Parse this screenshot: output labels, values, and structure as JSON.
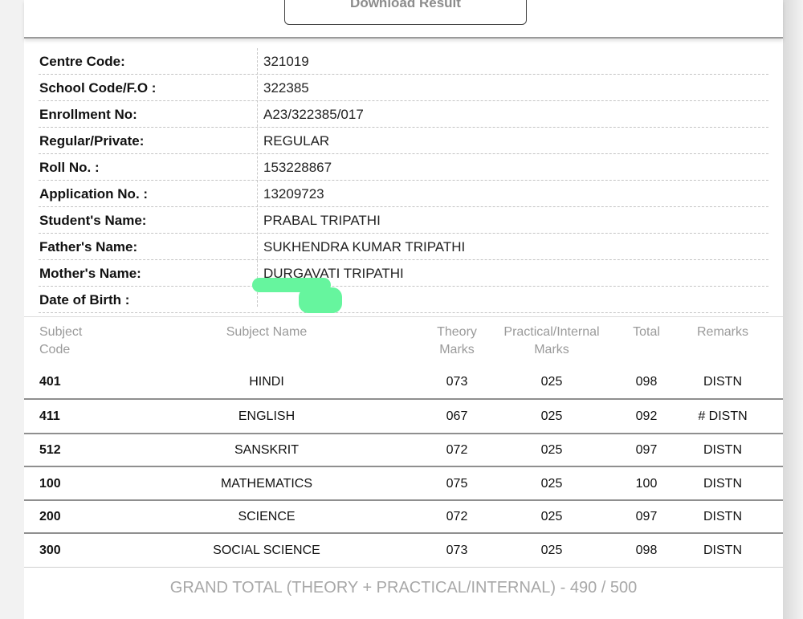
{
  "button": {
    "download_label": "Download Result"
  },
  "info": [
    {
      "label": "Centre Code:",
      "value": "321019"
    },
    {
      "label": "School Code/F.O :",
      "value": "322385"
    },
    {
      "label": "Enrollment No:",
      "value": "A23/322385/017"
    },
    {
      "label": "Regular/Private:",
      "value": "REGULAR"
    },
    {
      "label": "Roll No. :",
      "value": "153228867"
    },
    {
      "label": "Application No. :",
      "value": "13209723"
    },
    {
      "label": "Student's Name:",
      "value": "PRABAL TRIPATHI"
    },
    {
      "label": "Father's Name:",
      "value": "SUKHENDRA KUMAR TRIPATHI"
    },
    {
      "label": "Mother's Name:",
      "value": "DURGAVATI TRIPATHI"
    },
    {
      "label": "Date of Birth :",
      "value": ""
    }
  ],
  "table": {
    "headers": {
      "code": [
        "Subject",
        "Code"
      ],
      "name": "Subject Name",
      "theory": [
        "Theory",
        "Marks"
      ],
      "practical": [
        "Practical/Internal",
        "Marks"
      ],
      "total": "Total",
      "remarks": "Remarks"
    },
    "rows": [
      {
        "code": "401",
        "name": "HINDI",
        "theory": "073",
        "practical": "025",
        "total": "098",
        "remarks": "DISTN"
      },
      {
        "code": "411",
        "name": "ENGLISH",
        "theory": "067",
        "practical": "025",
        "total": "092",
        "remarks": "# DISTN"
      },
      {
        "code": "512",
        "name": "SANSKRIT",
        "theory": "072",
        "practical": "025",
        "total": "097",
        "remarks": "DISTN"
      },
      {
        "code": "100",
        "name": "MATHEMATICS",
        "theory": "075",
        "practical": "025",
        "total": "100",
        "remarks": "DISTN"
      },
      {
        "code": "200",
        "name": "SCIENCE",
        "theory": "072",
        "practical": "025",
        "total": "097",
        "remarks": "DISTN"
      },
      {
        "code": "300",
        "name": "SOCIAL SCIENCE",
        "theory": "073",
        "practical": "025",
        "total": "098",
        "remarks": "DISTN"
      }
    ]
  },
  "grand_total": "GRAND TOTAL (THEORY + PRACTICAL/INTERNAL) - 490 / 500",
  "colors": {
    "redaction": "#66f59e"
  }
}
